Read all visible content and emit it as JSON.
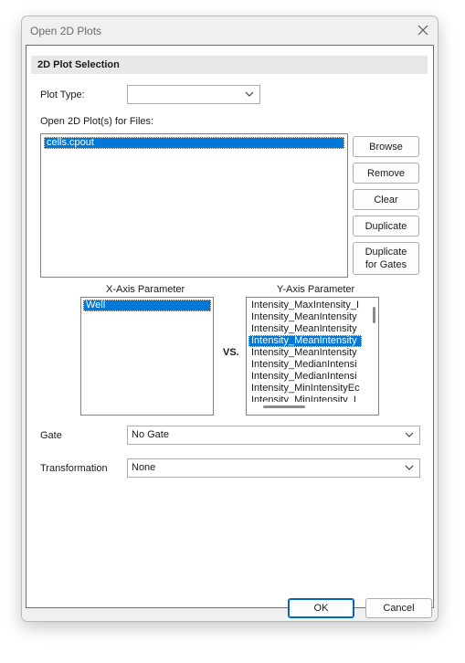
{
  "window": {
    "title": "Open 2D Plots"
  },
  "section": {
    "header": "2D Plot Selection"
  },
  "plot_type": {
    "label": "Plot Type:",
    "value": ""
  },
  "files": {
    "label": "Open 2D Plot(s) for Files:",
    "items": [
      "cells.cpout"
    ]
  },
  "file_buttons": {
    "browse": "Browse",
    "remove": "Remove",
    "clear": "Clear",
    "duplicate": "Duplicate",
    "duplicate_gates": "Duplicate\nfor Gates"
  },
  "x_axis": {
    "label": "X-Axis Parameter",
    "items": [
      "Well"
    ]
  },
  "vs_label": "VS.",
  "y_axis": {
    "label": "Y-Axis Parameter",
    "items": [
      "Intensity_MaxIntensity_I",
      "Intensity_MeanIntensity",
      "Intensity_MeanIntensity",
      "Intensity_MeanIntensity",
      "Intensity_MeanIntensity",
      "Intensity_MedianIntensi",
      "Intensity_MedianIntensi",
      "Intensity_MinIntensityEc",
      "Intensity_MinIntensity_I"
    ]
  },
  "gate": {
    "label": "Gate",
    "value": "No Gate"
  },
  "transformation": {
    "label": "Transformation",
    "value": "None"
  },
  "footer": {
    "ok": "OK",
    "cancel": "Cancel"
  },
  "colors": {
    "selection": "#0078d7",
    "default_button_border": "#0067c0"
  }
}
